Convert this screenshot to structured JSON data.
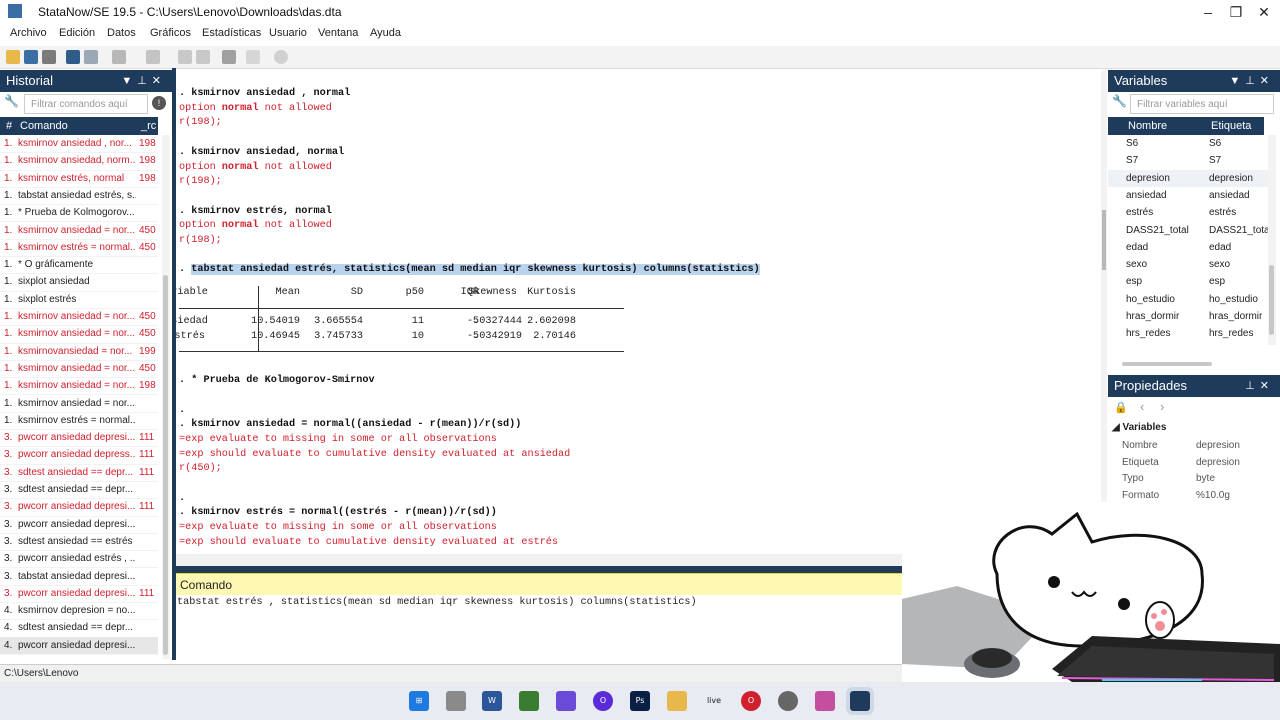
{
  "window": {
    "title": "StataNow/SE 19.5 - C:\\Users\\Lenovo\\Downloads\\das.dta"
  },
  "menu": [
    "Archivo",
    "Edición",
    "Datos",
    "Gráficos",
    "Estadísticas",
    "Usuario",
    "Ventana",
    "Ayuda"
  ],
  "history": {
    "title": "Historial",
    "filter_placeholder": "Filtrar comandos aquí",
    "col_num": "#",
    "col_command": "Comando",
    "col_rc": "_rc",
    "items": [
      {
        "n": "1.",
        "cmd": "ksmirnov ansiedad , nor...",
        "rc": "198",
        "err": true
      },
      {
        "n": "1.",
        "cmd": "ksmirnov ansiedad, norm...",
        "rc": "198",
        "err": true
      },
      {
        "n": "1.",
        "cmd": "ksmirnov estrés, normal",
        "rc": "198",
        "err": true
      },
      {
        "n": "1.",
        "cmd": "tabstat ansiedad estrés, s...",
        "rc": "",
        "err": false
      },
      {
        "n": "1.",
        "cmd": "* Prueba de Kolmogorov...",
        "rc": "",
        "err": false
      },
      {
        "n": "1.",
        "cmd": "ksmirnov ansiedad = nor...",
        "rc": "450",
        "err": true
      },
      {
        "n": "1.",
        "cmd": "ksmirnov estrés = normal...",
        "rc": "450",
        "err": true
      },
      {
        "n": "1.",
        "cmd": "* O gráficamente",
        "rc": "",
        "err": false
      },
      {
        "n": "1.",
        "cmd": "sixplot ansiedad",
        "rc": "",
        "err": false
      },
      {
        "n": "1.",
        "cmd": "sixplot estrés",
        "rc": "",
        "err": false
      },
      {
        "n": "1.",
        "cmd": "ksmirnov ansiedad = nor...",
        "rc": "450",
        "err": true
      },
      {
        "n": "1.",
        "cmd": "ksmirnov ansiedad = nor...",
        "rc": "450",
        "err": true
      },
      {
        "n": "1.",
        "cmd": "ksmirnovansiedad = nor...",
        "rc": "199",
        "err": true
      },
      {
        "n": "1.",
        "cmd": "ksmirnov ansiedad = nor...",
        "rc": "450",
        "err": true
      },
      {
        "n": "1.",
        "cmd": "ksmirnov ansiedad = nor...",
        "rc": "198",
        "err": true
      },
      {
        "n": "1.",
        "cmd": "ksmirnov ansiedad = nor...",
        "rc": "",
        "err": false
      },
      {
        "n": "1.",
        "cmd": "ksmirnov estrés = normal...",
        "rc": "",
        "err": false
      },
      {
        "n": "3.",
        "cmd": "pwcorr ansiedad depresi...",
        "rc": "111",
        "err": true
      },
      {
        "n": "3.",
        "cmd": "pwcorr ansiedad depress...",
        "rc": "111",
        "err": true
      },
      {
        "n": "3.",
        "cmd": "sdtest ansiedad == depr...",
        "rc": "111",
        "err": true
      },
      {
        "n": "3.",
        "cmd": "sdtest ansiedad == depr...",
        "rc": "",
        "err": false
      },
      {
        "n": "3.",
        "cmd": "pwcorr ansiedad depresi...",
        "rc": "111",
        "err": true
      },
      {
        "n": "3.",
        "cmd": "pwcorr ansiedad depresi...",
        "rc": "",
        "err": false
      },
      {
        "n": "3.",
        "cmd": "sdtest ansiedad == estrés",
        "rc": "",
        "err": false
      },
      {
        "n": "3.",
        "cmd": "pwcorr ansiedad estrés , ...",
        "rc": "",
        "err": false
      },
      {
        "n": "3.",
        "cmd": "tabstat ansiedad depresi...",
        "rc": "",
        "err": false
      },
      {
        "n": "3.",
        "cmd": "pwcorr ansiedad depresi...",
        "rc": "111",
        "err": true
      },
      {
        "n": "4.",
        "cmd": "ksmirnov depresion = no...",
        "rc": "",
        "err": false
      },
      {
        "n": "4.",
        "cmd": "sdtest ansiedad == depr...",
        "rc": "",
        "err": false
      },
      {
        "n": "4.",
        "cmd": "pwcorr ansiedad depresi...",
        "rc": "",
        "err": false
      }
    ]
  },
  "results": {
    "lines": [
      {
        "kind": "cmd",
        "text": ". ksmirnov ansiedad , normal"
      },
      {
        "kind": "err",
        "pre": "option ",
        "bold": "normal",
        "post": " not allowed"
      },
      {
        "kind": "rc",
        "text": "r(198);"
      },
      {
        "kind": "blank",
        "text": ""
      },
      {
        "kind": "cmd",
        "text": ". ksmirnov ansiedad, normal"
      },
      {
        "kind": "err",
        "pre": "option ",
        "bold": "normal",
        "post": " not allowed"
      },
      {
        "kind": "rc",
        "text": "r(198);"
      },
      {
        "kind": "blank",
        "text": ""
      },
      {
        "kind": "cmd",
        "text": ". ksmirnov estrés, normal"
      },
      {
        "kind": "err",
        "pre": "option ",
        "bold": "normal",
        "post": " not allowed"
      },
      {
        "kind": "rc",
        "text": "r(198);"
      },
      {
        "kind": "blank",
        "text": ""
      },
      {
        "kind": "cmdhl",
        "dot": ". ",
        "text": "tabstat ansiedad estrés, statistics(mean sd median iqr skewness kurtosis) columns(statistics)"
      }
    ],
    "table": {
      "headers": [
        "Variable",
        "Mean",
        "SD",
        "p50",
        "IQR",
        "Skewness",
        "Kurtosis"
      ],
      "rows": [
        [
          "ansiedad",
          "10.54019",
          "3.665554",
          "11",
          "5",
          "-.0327444",
          "2.602098"
        ],
        [
          "estrés",
          "10.46945",
          "3.745733",
          "10",
          "5",
          "-.0342919",
          "2.70146"
        ]
      ]
    },
    "after": [
      {
        "kind": "cmd",
        "text": ". * Prueba de Kolmogorov-Smirnov"
      },
      {
        "kind": "blank",
        "text": ""
      },
      {
        "kind": "cmd",
        "text": "."
      },
      {
        "kind": "cmd",
        "text": ". ksmirnov ansiedad = normal((ansiedad - r(mean))/r(sd))"
      },
      {
        "kind": "red",
        "text": "=exp evaluate to missing in some or all observations"
      },
      {
        "kind": "red",
        "text": "=exp should evaluate to cumulative density evaluated at ansiedad"
      },
      {
        "kind": "rc",
        "text": "r(450);"
      },
      {
        "kind": "blank",
        "text": ""
      },
      {
        "kind": "cmd",
        "text": "."
      },
      {
        "kind": "cmd",
        "text": ". ksmirnov estrés = normal((estrés - r(mean))/r(sd))"
      },
      {
        "kind": "red",
        "text": "=exp evaluate to missing in some or all observations"
      },
      {
        "kind": "red",
        "text": "=exp should evaluate to cumulative density evaluated at estrés"
      }
    ]
  },
  "command": {
    "title": "Comando",
    "value": "tabstat estrés , statistics(mean sd median iqr skewness kurtosis) columns(statistics)"
  },
  "variables": {
    "title": "Variables",
    "filter_placeholder": "Filtrar variables aquí",
    "col_name": "Nombre",
    "col_label": "Etiqueta",
    "items": [
      {
        "name": "S6",
        "label": "S6"
      },
      {
        "name": "S7",
        "label": "S7"
      },
      {
        "name": "depresion",
        "label": "depresion"
      },
      {
        "name": "ansiedad",
        "label": "ansiedad"
      },
      {
        "name": "estrés",
        "label": "estrés"
      },
      {
        "name": "DASS21_total",
        "label": "DASS21_tota"
      },
      {
        "name": "edad",
        "label": "edad"
      },
      {
        "name": "sexo",
        "label": "sexo"
      },
      {
        "name": "esp",
        "label": "esp"
      },
      {
        "name": "ho_estudio",
        "label": "ho_estudio"
      },
      {
        "name": "hras_dormir",
        "label": "hras_dormir"
      },
      {
        "name": "hrs_redes",
        "label": "hrs_redes"
      }
    ]
  },
  "properties": {
    "title": "Propiedades",
    "section": "Variables",
    "items": [
      {
        "key": "Nombre",
        "value": "depresion"
      },
      {
        "key": "Etiqueta",
        "value": "depresion"
      },
      {
        "key": "Typo",
        "value": "byte"
      },
      {
        "key": "Formato",
        "value": "%10.0g"
      }
    ]
  },
  "status": {
    "path": "C:\\Users\\Lenovo"
  },
  "taskbar": {
    "live_label": "live"
  },
  "colors": {
    "panel_header": "#1f3b5c",
    "error": "#d0202e",
    "highlight": "#b9d3ee",
    "command_bar": "#fff8b3"
  }
}
